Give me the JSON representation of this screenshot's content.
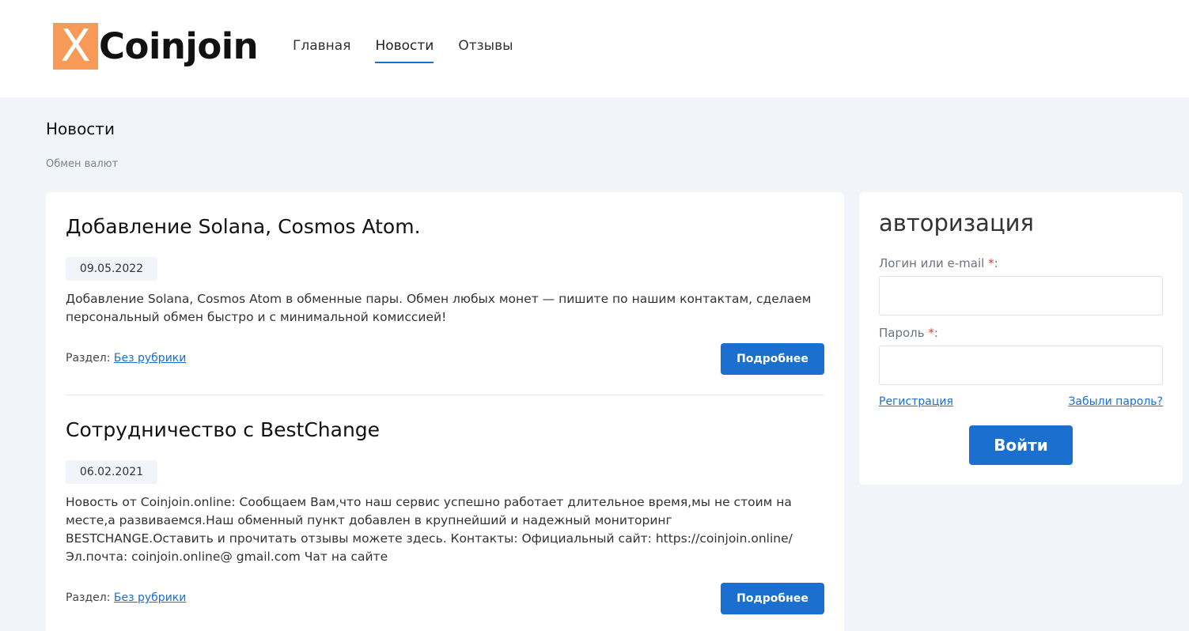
{
  "header": {
    "logo_mark": "X",
    "logo_text": "Coinjoin",
    "nav": [
      {
        "label": "Главная"
      },
      {
        "label": "Новости"
      },
      {
        "label": "Отзывы"
      }
    ],
    "active_nav": "Новости"
  },
  "page": {
    "title": "Новости",
    "breadcrumb": "Обмен валют"
  },
  "posts": [
    {
      "title": "Добавление Solana, Cosmos Atom.",
      "date": "09.05.2022",
      "text": "Добавление Solana, Cosmos Atom в обменные пары. Обмен любых монет — пишите по нашим контактам, сделаем персональный обмен быстро и с минимальной комиссией!",
      "section_label": "Раздел:",
      "section_link": "Без рубрики",
      "more_label": "Подробнее"
    },
    {
      "title": "Сотрудничество с BestChange",
      "date": "06.02.2021",
      "text": "Новость от Coinjoin.online: Сообщаем Вам,что наш сервис успешно работает длительное время,мы не стоим на месте,а развиваемся.Наш обменный пункт добавлен в крупнейший и надежный мониторинг BESTCHANGE.Оставить и прочитать отзывы можете здесь. Контакты: Официальный сайт: https://coinjoin.online/ Эл.почта: coinjoin.online@ gmail.com Чат на сайте",
      "section_label": "Раздел:",
      "section_link": "Без рубрики",
      "more_label": "Подробнее"
    }
  ],
  "auth": {
    "title": "авторизация",
    "login_label": "Логин или e-mail",
    "password_label": "Пароль",
    "required_mark": "*",
    "label_colon": ":",
    "login_value": "",
    "password_value": "",
    "register_link": "Регистрация",
    "forgot_link": "Забыли пароль?",
    "submit_label": "Войти"
  },
  "colors": {
    "accent": "#1a6fcf",
    "logo_mark_bg": "#f79a57",
    "page_bg": "#f1f4f9",
    "required": "#e53935"
  }
}
